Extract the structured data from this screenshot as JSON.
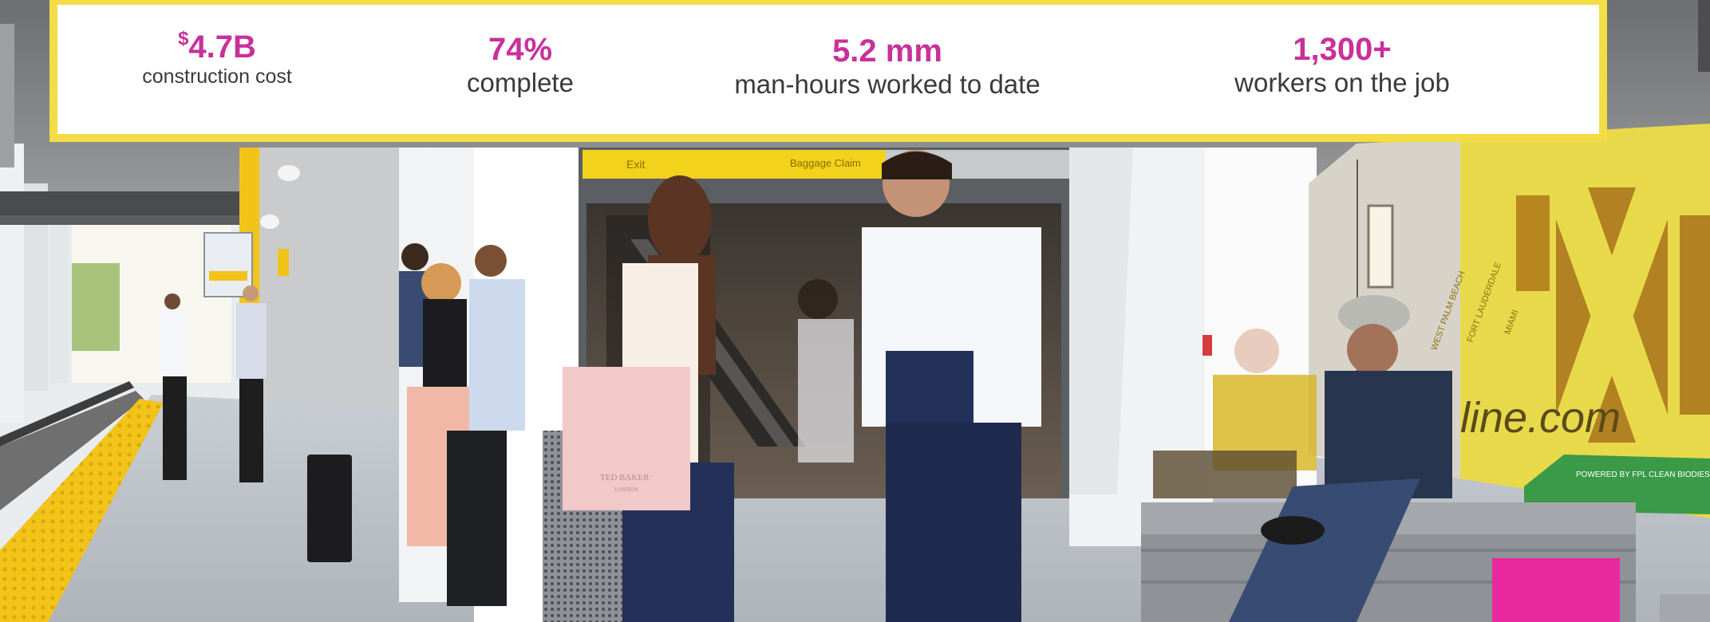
{
  "stats": [
    {
      "prefix": "$",
      "value": "4.7B",
      "label": "construction cost"
    },
    {
      "value": "74%",
      "label": "complete"
    },
    {
      "value": "5.2 mm",
      "label": "man-hours worked to date"
    },
    {
      "value": "1,300+",
      "label": "workers on the job"
    }
  ],
  "photo": {
    "signage": {
      "exit": "Exit",
      "baggage": "Baggage Claim"
    },
    "bag_brand": "TED BAKER",
    "bag_city": "LONDON",
    "train_url_fragment": "line.com",
    "train_stops": [
      "WEST PALM BEACH",
      "FORT LAUDERDALE",
      "MIAMI"
    ],
    "train_badge": "POWERED BY FPL CLEAN BIODIESEL"
  },
  "colors": {
    "accent_magenta": "#c8319a",
    "panel_border_yellow": "#f3dc45",
    "platform_edge_yellow": "#f2c318",
    "train_yellow": "#e8d94a",
    "bench_magenta": "#e8289d"
  }
}
